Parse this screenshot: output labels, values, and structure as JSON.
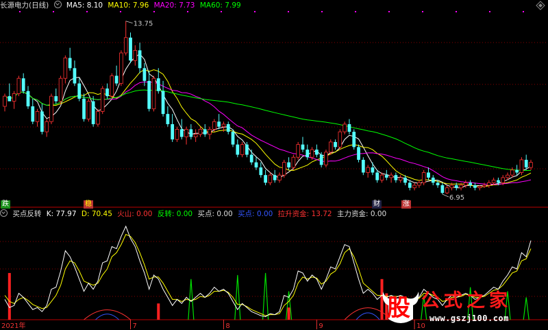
{
  "main_header": {
    "title": "长源电力(日线)",
    "ma5": "MA5: 8.10",
    "ma10": "MA10: 7.96",
    "ma20": "MA20: 7.73",
    "ma60": "MA60: 7.99"
  },
  "sub_header": {
    "name": "买点反转",
    "k": "K: 77.97",
    "d": "D: 70.45",
    "huoshan": "火山: 0.00",
    "fanzhuan": "反转: 0.00",
    "maidian1": "买点: 0.00",
    "maidian2": "买点: 0.00",
    "lasheng": "拉升资金: 13.72",
    "zhuli": "主力资金: 0.00"
  },
  "annotations": {
    "high_label": "13.75",
    "low_label": "6.95",
    "tag_die": "跌",
    "tag_wen": "稳",
    "tag_cai": "财",
    "tag_zhang": "涨"
  },
  "x_axis": {
    "year_label": "2021年",
    "month_labels": [
      "7",
      "8",
      "9",
      "10"
    ]
  },
  "logo": {
    "icon_text": "股",
    "text": "公式之家",
    "url": "www.gszj100.com"
  },
  "colors": {
    "up": "#ff3232",
    "down": "#54ffff",
    "ma5": "#ffffff",
    "ma10": "#ffff00",
    "ma20": "#ff00ff",
    "ma60": "#00ff00",
    "k": "#ffffff",
    "d": "#ffff00",
    "grid": "#8b0000"
  },
  "chart_data": {
    "type": "candlestick",
    "title": "长源电力(日线)",
    "high_marker": 13.75,
    "low_marker": 6.95,
    "candles": [
      [
        10.4,
        10.9,
        10.2,
        10.8
      ],
      [
        10.8,
        11.3,
        10.6,
        10.6
      ],
      [
        10.6,
        11.0,
        10.3,
        10.9
      ],
      [
        10.9,
        11.6,
        10.8,
        11.5
      ],
      [
        11.5,
        11.7,
        10.9,
        11.0
      ],
      [
        11.0,
        11.2,
        10.3,
        10.4
      ],
      [
        10.4,
        10.7,
        9.7,
        9.8
      ],
      [
        9.8,
        10.3,
        9.6,
        10.2
      ],
      [
        10.2,
        10.5,
        9.3,
        9.4
      ],
      [
        9.4,
        9.9,
        9.2,
        9.8
      ],
      [
        9.8,
        10.9,
        9.7,
        10.8
      ],
      [
        10.8,
        11.1,
        10.5,
        10.6
      ],
      [
        10.6,
        11.6,
        10.5,
        11.5
      ],
      [
        11.5,
        12.4,
        11.3,
        12.3
      ],
      [
        12.3,
        12.7,
        11.8,
        11.9
      ],
      [
        11.9,
        12.2,
        11.2,
        11.3
      ],
      [
        11.3,
        11.5,
        10.6,
        10.7
      ],
      [
        10.7,
        10.9,
        9.8,
        9.9
      ],
      [
        9.9,
        10.7,
        9.8,
        10.6
      ],
      [
        10.6,
        10.8,
        9.6,
        9.7
      ],
      [
        9.7,
        10.3,
        9.6,
        10.2
      ],
      [
        10.2,
        11.2,
        10.1,
        11.1
      ],
      [
        11.1,
        11.3,
        10.7,
        10.8
      ],
      [
        10.8,
        11.7,
        10.7,
        11.6
      ],
      [
        11.6,
        12.0,
        11.2,
        11.3
      ],
      [
        11.3,
        12.6,
        11.2,
        12.5
      ],
      [
        12.5,
        13.75,
        12.4,
        13.1
      ],
      [
        13.1,
        13.3,
        12.1,
        12.2
      ],
      [
        12.2,
        12.8,
        12.0,
        12.6
      ],
      [
        12.6,
        12.9,
        11.7,
        11.9
      ],
      [
        11.9,
        12.1,
        11.2,
        11.4
      ],
      [
        11.4,
        11.8,
        10.2,
        10.3
      ],
      [
        10.3,
        11.6,
        10.2,
        11.5
      ],
      [
        11.5,
        11.9,
        10.9,
        11.0
      ],
      [
        11.0,
        11.4,
        10.0,
        10.1
      ],
      [
        10.1,
        10.4,
        9.6,
        9.7
      ],
      [
        9.7,
        10.1,
        9.0,
        9.1
      ],
      [
        9.1,
        9.6,
        9.0,
        9.5
      ],
      [
        9.5,
        9.9,
        9.1,
        9.2
      ],
      [
        9.2,
        9.6,
        8.9,
        9.5
      ],
      [
        9.5,
        9.7,
        9.1,
        9.2
      ],
      [
        9.2,
        9.5,
        9.0,
        9.3
      ],
      [
        9.3,
        9.6,
        9.2,
        9.5
      ],
      [
        9.5,
        9.7,
        9.2,
        9.3
      ],
      [
        9.3,
        9.6,
        9.1,
        9.5
      ],
      [
        9.5,
        9.9,
        9.4,
        9.8
      ],
      [
        9.8,
        10.1,
        9.5,
        9.6
      ],
      [
        9.6,
        9.8,
        9.4,
        9.7
      ],
      [
        9.7,
        9.8,
        9.3,
        9.4
      ],
      [
        9.4,
        9.5,
        8.8,
        8.9
      ],
      [
        8.9,
        9.1,
        8.4,
        8.5
      ],
      [
        8.5,
        9.0,
        8.4,
        8.9
      ],
      [
        8.9,
        9.0,
        8.4,
        8.5
      ],
      [
        8.5,
        8.7,
        8.1,
        8.2
      ],
      [
        8.2,
        8.4,
        7.9,
        8.0
      ],
      [
        8.0,
        8.2,
        7.6,
        7.7
      ],
      [
        7.7,
        7.9,
        7.3,
        7.4
      ],
      [
        7.4,
        7.8,
        7.3,
        7.7
      ],
      [
        7.7,
        7.9,
        7.4,
        7.5
      ],
      [
        7.5,
        7.8,
        7.4,
        7.7
      ],
      [
        7.7,
        8.3,
        7.6,
        8.2
      ],
      [
        8.2,
        8.4,
        7.9,
        8.0
      ],
      [
        8.0,
        8.5,
        7.9,
        8.4
      ],
      [
        8.4,
        9.0,
        8.3,
        8.9
      ],
      [
        8.9,
        9.2,
        8.6,
        8.7
      ],
      [
        8.7,
        8.9,
        8.3,
        8.4
      ],
      [
        8.4,
        8.8,
        8.3,
        8.7
      ],
      [
        8.7,
        8.9,
        8.4,
        8.5
      ],
      [
        8.5,
        8.6,
        8.0,
        8.1
      ],
      [
        8.1,
        8.7,
        8.0,
        8.6
      ],
      [
        8.6,
        9.1,
        8.5,
        9.0
      ],
      [
        9.0,
        9.1,
        8.7,
        8.8
      ],
      [
        8.8,
        9.5,
        8.7,
        9.4
      ],
      [
        9.4,
        9.8,
        9.3,
        9.7
      ],
      [
        9.7,
        9.9,
        9.3,
        9.4
      ],
      [
        9.4,
        9.5,
        8.7,
        8.8
      ],
      [
        8.8,
        8.9,
        8.2,
        8.3
      ],
      [
        8.3,
        8.4,
        7.7,
        7.8
      ],
      [
        7.8,
        8.1,
        7.6,
        8.0
      ],
      [
        8.0,
        8.2,
        7.7,
        7.8
      ],
      [
        7.8,
        7.9,
        7.4,
        7.5
      ],
      [
        7.5,
        7.8,
        7.4,
        7.7
      ],
      [
        7.7,
        7.9,
        7.5,
        7.6
      ],
      [
        7.6,
        7.8,
        7.4,
        7.7
      ],
      [
        7.7,
        7.8,
        7.4,
        7.5
      ],
      [
        7.5,
        7.7,
        7.4,
        7.6
      ],
      [
        7.6,
        7.7,
        7.3,
        7.4
      ],
      [
        7.4,
        7.5,
        7.1,
        7.2
      ],
      [
        7.2,
        7.4,
        7.1,
        7.3
      ],
      [
        7.3,
        7.5,
        7.2,
        7.4
      ],
      [
        7.4,
        7.9,
        7.3,
        7.8
      ],
      [
        7.8,
        8.0,
        7.5,
        7.6
      ],
      [
        7.6,
        7.7,
        7.3,
        7.4
      ],
      [
        7.4,
        7.5,
        7.2,
        7.3
      ],
      [
        7.3,
        7.4,
        6.95,
        7.0
      ],
      [
        7.0,
        7.3,
        6.95,
        7.2
      ],
      [
        7.2,
        7.4,
        7.1,
        7.3
      ],
      [
        7.3,
        7.4,
        7.1,
        7.2
      ],
      [
        7.2,
        7.4,
        7.1,
        7.3
      ],
      [
        7.3,
        7.5,
        7.2,
        7.4
      ],
      [
        7.4,
        7.5,
        7.2,
        7.3
      ],
      [
        7.3,
        7.4,
        7.1,
        7.2
      ],
      [
        7.2,
        7.3,
        7.1,
        7.25
      ],
      [
        7.25,
        7.4,
        7.2,
        7.3
      ],
      [
        7.3,
        7.5,
        7.2,
        7.4
      ],
      [
        7.4,
        7.6,
        7.3,
        7.5
      ],
      [
        7.5,
        7.6,
        7.3,
        7.4
      ],
      [
        7.4,
        7.7,
        7.3,
        7.6
      ],
      [
        7.6,
        7.8,
        7.5,
        7.7
      ],
      [
        7.7,
        8.0,
        7.6,
        7.9
      ],
      [
        7.9,
        8.1,
        7.7,
        7.8
      ],
      [
        7.8,
        8.4,
        7.7,
        8.3
      ],
      [
        8.3,
        8.5,
        7.9,
        8.0
      ],
      [
        8.0,
        8.3,
        7.9,
        8.2
      ]
    ],
    "kd_k": [
      20,
      12,
      14,
      26,
      22,
      16,
      10,
      12,
      8,
      14,
      30,
      32,
      48,
      68,
      62,
      52,
      40,
      28,
      36,
      30,
      38,
      56,
      58,
      72,
      70,
      82,
      92,
      80,
      72,
      58,
      46,
      30,
      44,
      40,
      30,
      22,
      14,
      20,
      16,
      22,
      18,
      22,
      26,
      22,
      26,
      32,
      28,
      30,
      26,
      18,
      10,
      16,
      12,
      8,
      6,
      4,
      3,
      6,
      5,
      8,
      24,
      22,
      30,
      48,
      46,
      38,
      44,
      40,
      30,
      40,
      52,
      50,
      62,
      74,
      72,
      56,
      40,
      26,
      30,
      26,
      20,
      24,
      22,
      24,
      22,
      24,
      22,
      18,
      20,
      22,
      30,
      26,
      22,
      20,
      14,
      20,
      24,
      22,
      24,
      26,
      24,
      20,
      22,
      24,
      28,
      32,
      30,
      38,
      44,
      52,
      50,
      66,
      62,
      78
    ],
    "kd_d": [
      24,
      18,
      16,
      20,
      22,
      19,
      15,
      13,
      11,
      12,
      18,
      24,
      34,
      50,
      58,
      56,
      48,
      38,
      36,
      34,
      36,
      44,
      50,
      62,
      66,
      74,
      84,
      82,
      76,
      66,
      54,
      40,
      42,
      42,
      36,
      28,
      20,
      20,
      18,
      20,
      19,
      20,
      23,
      22,
      24,
      28,
      28,
      29,
      27,
      22,
      15,
      15,
      13,
      10,
      8,
      6,
      4,
      5,
      5,
      6,
      14,
      18,
      24,
      36,
      42,
      40,
      42,
      41,
      35,
      38,
      45,
      48,
      55,
      66,
      70,
      62,
      50,
      36,
      32,
      28,
      24,
      24,
      23,
      23,
      23,
      23,
      22,
      20,
      20,
      21,
      26,
      26,
      24,
      22,
      18,
      19,
      22,
      22,
      23,
      25,
      24,
      22,
      22,
      23,
      26,
      29,
      30,
      34,
      40,
      46,
      48,
      58,
      60,
      70
    ],
    "green_spikes": [
      {
        "i": 40,
        "v": 40
      },
      {
        "i": 50,
        "v": 44
      },
      {
        "i": 56,
        "v": 46
      },
      {
        "i": 61,
        "v": 28
      },
      {
        "i": 90,
        "v": 24
      },
      {
        "i": 100,
        "v": 32
      },
      {
        "i": 108,
        "v": 28
      },
      {
        "i": 112,
        "v": 22
      }
    ],
    "red_bars": [
      {
        "i": 1,
        "v": 46
      },
      {
        "i": 33,
        "v": 16
      },
      {
        "i": 61,
        "v": 12
      },
      {
        "i": 81,
        "v": 40
      },
      {
        "i": 82,
        "v": 26
      }
    ],
    "red_humps": [
      {
        "i": 22,
        "v": 14
      },
      {
        "i": 78,
        "v": 18
      }
    ]
  }
}
